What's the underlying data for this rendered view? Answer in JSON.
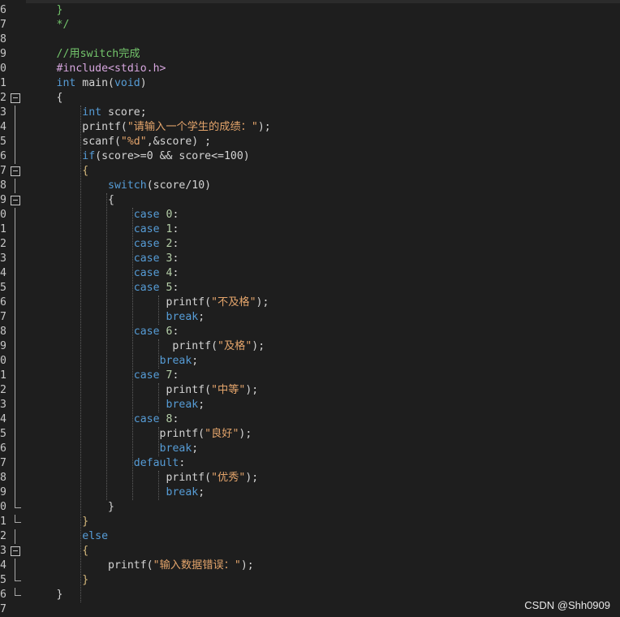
{
  "editor": {
    "watermark": "CSDN @Shh0909",
    "colors": {
      "background": "#1e1e1e",
      "comment": "#73c46b",
      "keyword": "#569cd6",
      "string": "#e3a46b",
      "number": "#b5cea8",
      "preprocessor": "#d6a6de",
      "plain": "#d4d4d4"
    },
    "lines": [
      {
        "n": "6",
        "fold": "",
        "tokens": [
          {
            "t": "        }",
            "c": "t-comment"
          }
        ]
      },
      {
        "n": "7",
        "fold": "",
        "tokens": [
          {
            "t": "        */",
            "c": "t-comment"
          }
        ]
      },
      {
        "n": "8",
        "fold": "",
        "tokens": []
      },
      {
        "n": "9",
        "fold": "",
        "tokens": [
          {
            "t": "        //用switch完成",
            "c": "t-comment"
          }
        ]
      },
      {
        "n": "0",
        "fold": "",
        "tokens": [
          {
            "t": "        #include<stdio.h>",
            "c": "t-pre"
          }
        ]
      },
      {
        "n": "1",
        "fold": "",
        "tokens": [
          {
            "t": "        int",
            "c": "t-kw"
          },
          {
            "t": " main(",
            "c": "t-plain"
          },
          {
            "t": "void",
            "c": "t-kw"
          },
          {
            "t": ")",
            "c": "t-plain"
          }
        ]
      },
      {
        "n": "2",
        "fold": "box",
        "tokens": [
          {
            "t": "        {",
            "c": "t-plain"
          }
        ]
      },
      {
        "n": "3",
        "fold": "line",
        "tokens": [
          {
            "t": "            ",
            "c": "t-plain"
          },
          {
            "t": "int",
            "c": "t-kw"
          },
          {
            "t": " score;",
            "c": "t-plain"
          }
        ]
      },
      {
        "n": "4",
        "fold": "line",
        "tokens": [
          {
            "t": "            printf(",
            "c": "t-plain"
          },
          {
            "t": "\"请输入一个学生的成绩：\"",
            "c": "t-str"
          },
          {
            "t": ");",
            "c": "t-plain"
          }
        ]
      },
      {
        "n": "5",
        "fold": "line",
        "tokens": [
          {
            "t": "            scanf(",
            "c": "t-plain"
          },
          {
            "t": "\"%d\"",
            "c": "t-str"
          },
          {
            "t": ",&score) ;",
            "c": "t-plain"
          }
        ]
      },
      {
        "n": "6",
        "fold": "line",
        "tokens": [
          {
            "t": "            ",
            "c": "t-plain"
          },
          {
            "t": "if",
            "c": "t-kw"
          },
          {
            "t": "(score>=0 && score<=100)",
            "c": "t-plain"
          }
        ]
      },
      {
        "n": "7",
        "fold": "box",
        "tokens": [
          {
            "t": "            {",
            "c": "t-brace"
          }
        ]
      },
      {
        "n": "8",
        "fold": "line",
        "tokens": [
          {
            "t": "                ",
            "c": "t-plain"
          },
          {
            "t": "switch",
            "c": "t-kw"
          },
          {
            "t": "(score/10)",
            "c": "t-plain"
          }
        ]
      },
      {
        "n": "9",
        "fold": "box",
        "tokens": [
          {
            "t": "                {",
            "c": "t-plain"
          }
        ]
      },
      {
        "n": "0",
        "fold": "line",
        "tokens": [
          {
            "t": "                    ",
            "c": "t-plain"
          },
          {
            "t": "case",
            "c": "t-kw"
          },
          {
            "t": " ",
            "c": "t-plain"
          },
          {
            "t": "0",
            "c": "t-num"
          },
          {
            "t": ":",
            "c": "t-plain"
          }
        ]
      },
      {
        "n": "1",
        "fold": "line",
        "tokens": [
          {
            "t": "                    ",
            "c": "t-plain"
          },
          {
            "t": "case",
            "c": "t-kw"
          },
          {
            "t": " ",
            "c": "t-plain"
          },
          {
            "t": "1",
            "c": "t-num"
          },
          {
            "t": ":",
            "c": "t-plain"
          }
        ]
      },
      {
        "n": "2",
        "fold": "line",
        "tokens": [
          {
            "t": "                    ",
            "c": "t-plain"
          },
          {
            "t": "case",
            "c": "t-kw"
          },
          {
            "t": " ",
            "c": "t-plain"
          },
          {
            "t": "2",
            "c": "t-num"
          },
          {
            "t": ":",
            "c": "t-plain"
          }
        ]
      },
      {
        "n": "3",
        "fold": "line",
        "tokens": [
          {
            "t": "                    ",
            "c": "t-plain"
          },
          {
            "t": "case",
            "c": "t-kw"
          },
          {
            "t": " ",
            "c": "t-plain"
          },
          {
            "t": "3",
            "c": "t-num"
          },
          {
            "t": ":",
            "c": "t-plain"
          }
        ]
      },
      {
        "n": "4",
        "fold": "line",
        "tokens": [
          {
            "t": "                    ",
            "c": "t-plain"
          },
          {
            "t": "case",
            "c": "t-kw"
          },
          {
            "t": " ",
            "c": "t-plain"
          },
          {
            "t": "4",
            "c": "t-num"
          },
          {
            "t": ":",
            "c": "t-plain"
          }
        ]
      },
      {
        "n": "5",
        "fold": "line",
        "tokens": [
          {
            "t": "                    ",
            "c": "t-plain"
          },
          {
            "t": "case",
            "c": "t-kw"
          },
          {
            "t": " ",
            "c": "t-plain"
          },
          {
            "t": "5",
            "c": "t-num"
          },
          {
            "t": ":",
            "c": "t-plain"
          }
        ]
      },
      {
        "n": "6",
        "fold": "line",
        "tokens": [
          {
            "t": "                         printf(",
            "c": "t-plain"
          },
          {
            "t": "\"不及格\"",
            "c": "t-str"
          },
          {
            "t": ");",
            "c": "t-plain"
          }
        ]
      },
      {
        "n": "7",
        "fold": "line",
        "tokens": [
          {
            "t": "                         ",
            "c": "t-plain"
          },
          {
            "t": "break",
            "c": "t-kw"
          },
          {
            "t": ";",
            "c": "t-plain"
          }
        ]
      },
      {
        "n": "8",
        "fold": "line",
        "tokens": [
          {
            "t": "                    ",
            "c": "t-plain"
          },
          {
            "t": "case",
            "c": "t-kw"
          },
          {
            "t": " ",
            "c": "t-plain"
          },
          {
            "t": "6",
            "c": "t-num"
          },
          {
            "t": ":",
            "c": "t-plain"
          }
        ]
      },
      {
        "n": "9",
        "fold": "line",
        "tokens": [
          {
            "t": "                          printf(",
            "c": "t-plain"
          },
          {
            "t": "\"及格\"",
            "c": "t-str"
          },
          {
            "t": ");",
            "c": "t-plain"
          }
        ]
      },
      {
        "n": "0",
        "fold": "line",
        "tokens": [
          {
            "t": "                        ",
            "c": "t-plain"
          },
          {
            "t": "break",
            "c": "t-kw"
          },
          {
            "t": ";",
            "c": "t-plain"
          }
        ]
      },
      {
        "n": "1",
        "fold": "line",
        "tokens": [
          {
            "t": "                    ",
            "c": "t-plain"
          },
          {
            "t": "case",
            "c": "t-kw"
          },
          {
            "t": " ",
            "c": "t-plain"
          },
          {
            "t": "7",
            "c": "t-num"
          },
          {
            "t": ":",
            "c": "t-plain"
          }
        ]
      },
      {
        "n": "2",
        "fold": "line",
        "tokens": [
          {
            "t": "                         printf(",
            "c": "t-plain"
          },
          {
            "t": "\"中等\"",
            "c": "t-str"
          },
          {
            "t": ");",
            "c": "t-plain"
          }
        ]
      },
      {
        "n": "3",
        "fold": "line",
        "tokens": [
          {
            "t": "                         ",
            "c": "t-plain"
          },
          {
            "t": "break",
            "c": "t-kw"
          },
          {
            "t": ";",
            "c": "t-plain"
          }
        ]
      },
      {
        "n": "4",
        "fold": "line",
        "tokens": [
          {
            "t": "                    ",
            "c": "t-plain"
          },
          {
            "t": "case",
            "c": "t-kw"
          },
          {
            "t": " ",
            "c": "t-plain"
          },
          {
            "t": "8",
            "c": "t-num"
          },
          {
            "t": ":",
            "c": "t-plain"
          }
        ]
      },
      {
        "n": "5",
        "fold": "line",
        "tokens": [
          {
            "t": "                        printf(",
            "c": "t-plain"
          },
          {
            "t": "\"良好\"",
            "c": "t-str"
          },
          {
            "t": ");",
            "c": "t-plain"
          }
        ]
      },
      {
        "n": "6",
        "fold": "line",
        "tokens": [
          {
            "t": "                        ",
            "c": "t-plain"
          },
          {
            "t": "break",
            "c": "t-kw"
          },
          {
            "t": ";",
            "c": "t-plain"
          }
        ]
      },
      {
        "n": "7",
        "fold": "line",
        "tokens": [
          {
            "t": "                    ",
            "c": "t-plain"
          },
          {
            "t": "default",
            "c": "t-kw"
          },
          {
            "t": ":",
            "c": "t-plain"
          }
        ]
      },
      {
        "n": "8",
        "fold": "line",
        "tokens": [
          {
            "t": "                         printf(",
            "c": "t-plain"
          },
          {
            "t": "\"优秀\"",
            "c": "t-str"
          },
          {
            "t": ");",
            "c": "t-plain"
          }
        ]
      },
      {
        "n": "9",
        "fold": "line",
        "tokens": [
          {
            "t": "                         ",
            "c": "t-plain"
          },
          {
            "t": "break",
            "c": "t-kw"
          },
          {
            "t": ";",
            "c": "t-plain"
          }
        ]
      },
      {
        "n": "0",
        "fold": "end",
        "tokens": [
          {
            "t": "                }",
            "c": "t-plain"
          }
        ]
      },
      {
        "n": "1",
        "fold": "end",
        "tokens": [
          {
            "t": "            }",
            "c": "t-brace"
          }
        ]
      },
      {
        "n": "2",
        "fold": "line",
        "tokens": [
          {
            "t": "            ",
            "c": "t-plain"
          },
          {
            "t": "else",
            "c": "t-kw"
          }
        ]
      },
      {
        "n": "3",
        "fold": "box",
        "tokens": [
          {
            "t": "            {",
            "c": "t-brace"
          }
        ]
      },
      {
        "n": "4",
        "fold": "line",
        "tokens": [
          {
            "t": "                printf(",
            "c": "t-plain"
          },
          {
            "t": "\"输入数据错误：\"",
            "c": "t-str"
          },
          {
            "t": ");",
            "c": "t-plain"
          }
        ]
      },
      {
        "n": "5",
        "fold": "end",
        "tokens": [
          {
            "t": "            }",
            "c": "t-brace"
          }
        ]
      },
      {
        "n": "6",
        "fold": "end",
        "tokens": [
          {
            "t": "        }",
            "c": "t-plain"
          }
        ]
      },
      {
        "n": "7",
        "fold": "",
        "tokens": []
      }
    ]
  }
}
